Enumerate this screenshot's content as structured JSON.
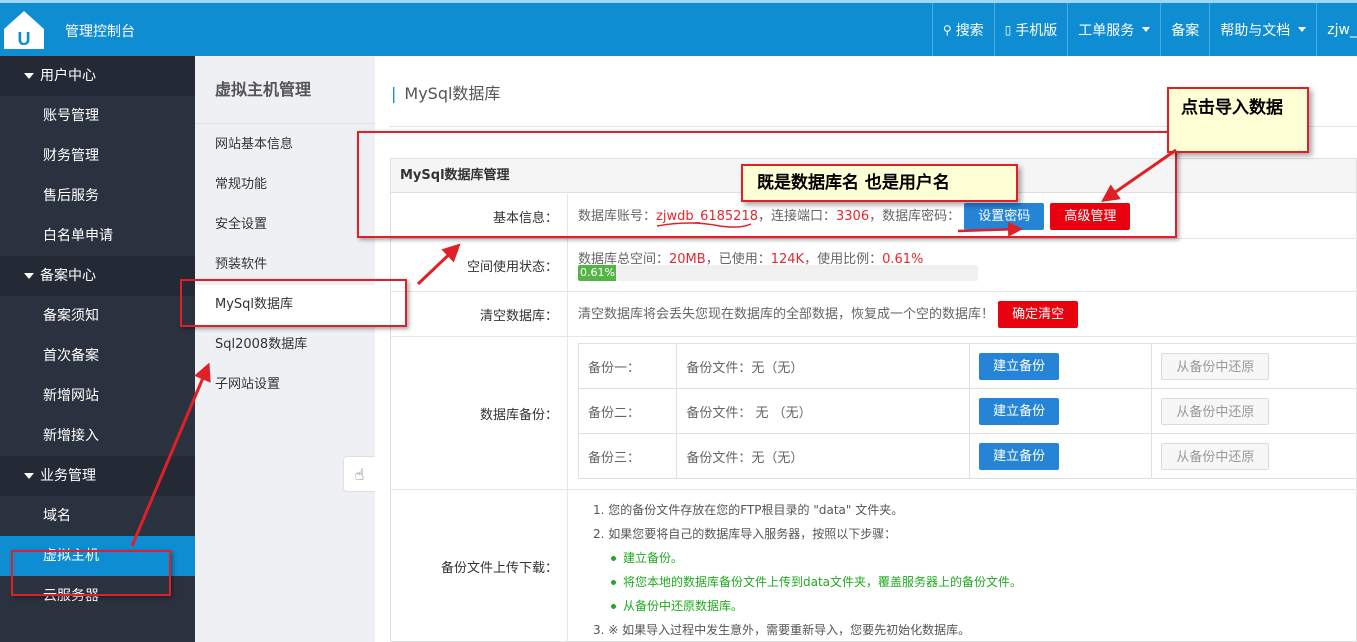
{
  "topbar": {
    "console": "管理控制台",
    "nav": [
      {
        "icon": "search-icon",
        "glyph": "🔍",
        "label": "搜索"
      },
      {
        "icon": "mobile-icon",
        "glyph": "▯",
        "label": "手机版"
      },
      {
        "label": "工单服务",
        "dropdown": true
      },
      {
        "label": "备案"
      },
      {
        "label": "帮助与文档",
        "dropdown": true
      },
      {
        "label": "zjw_"
      }
    ]
  },
  "sidebar": {
    "groups": [
      {
        "title": "用户中心",
        "items": [
          "账号管理",
          "财务管理",
          "售后服务",
          "白名单申请"
        ]
      },
      {
        "title": "备案中心",
        "items": [
          "备案须知",
          "首次备案",
          "新增网站",
          "新增接入"
        ]
      },
      {
        "title": "业务管理",
        "items": [
          "域名",
          "虚拟主机",
          "云服务器"
        ]
      }
    ],
    "active": "虚拟主机"
  },
  "submenu": {
    "title": "虚拟主机管理",
    "items": [
      "网站基本信息",
      "常规功能",
      "安全设置",
      "预装软件",
      "MySql数据库",
      "Sql2008数据库",
      "子网站设置"
    ],
    "active": "MySql数据库"
  },
  "main": {
    "title": "MySql数据库",
    "panel_title": "MySql数据库管理",
    "basic": {
      "label": "基本信息：",
      "account_prefix": "数据库账号：",
      "account": "zjwdb_6185218",
      "port_prefix": "，连接端口：",
      "port": "3306",
      "pwd_prefix": "，数据库密码：",
      "set_pwd": "设置密码",
      "advanced": "高级管理"
    },
    "space": {
      "label": "空间使用状态：",
      "total_prefix": "数据库总空间：",
      "total": "20MB",
      "used_prefix": "，已使用：",
      "used": "124K",
      "ratio_prefix": "，使用比例：",
      "ratio": "0.61%",
      "bar_text": "0.61%",
      "fraction": 0.0061
    },
    "clear": {
      "label": "清空数据库：",
      "text": "清空数据库将会丢失您现在数据库的全部数据，恢复成一个空的数据库！",
      "button": "确定清空"
    },
    "backup": {
      "label": "数据库备份：",
      "rows": [
        {
          "name": "备份一：",
          "file": "备份文件：无（无）",
          "create": "建立备份",
          "restore": "从备份中还原"
        },
        {
          "name": "备份二：",
          "file": "备份文件： 无 （无）",
          "create": "建立备份",
          "restore": "从备份中还原"
        },
        {
          "name": "备份三：",
          "file": "备份文件：无（无）",
          "create": "建立备份",
          "restore": "从备份中还原"
        }
      ]
    },
    "upload": {
      "label": "备份文件上传下载：",
      "note1": "1. 您的备份文件存放在您的FTP根目录的 \"data\" 文件夹。",
      "note2": "2. 如果您要将自己的数据库导入服务器，按照以下步骤：",
      "steps": [
        "建立备份。",
        "将您本地的数据库备份文件上传到data文件夹，覆盖服务器上的备份文件。",
        "从备份中还原数据库。"
      ],
      "note3": "3. ※ 如果导入过程中发生意外，需要重新导入，您要先初始化数据库。"
    }
  },
  "annotations": {
    "callout_import": "点击导入数据",
    "callout_db": "既是数据库名 也是用户名"
  },
  "colors": {
    "brand": "#0e8dd2",
    "sidebar": "#2a3240",
    "danger": "#e8000f",
    "annotation": "#e01f26"
  }
}
